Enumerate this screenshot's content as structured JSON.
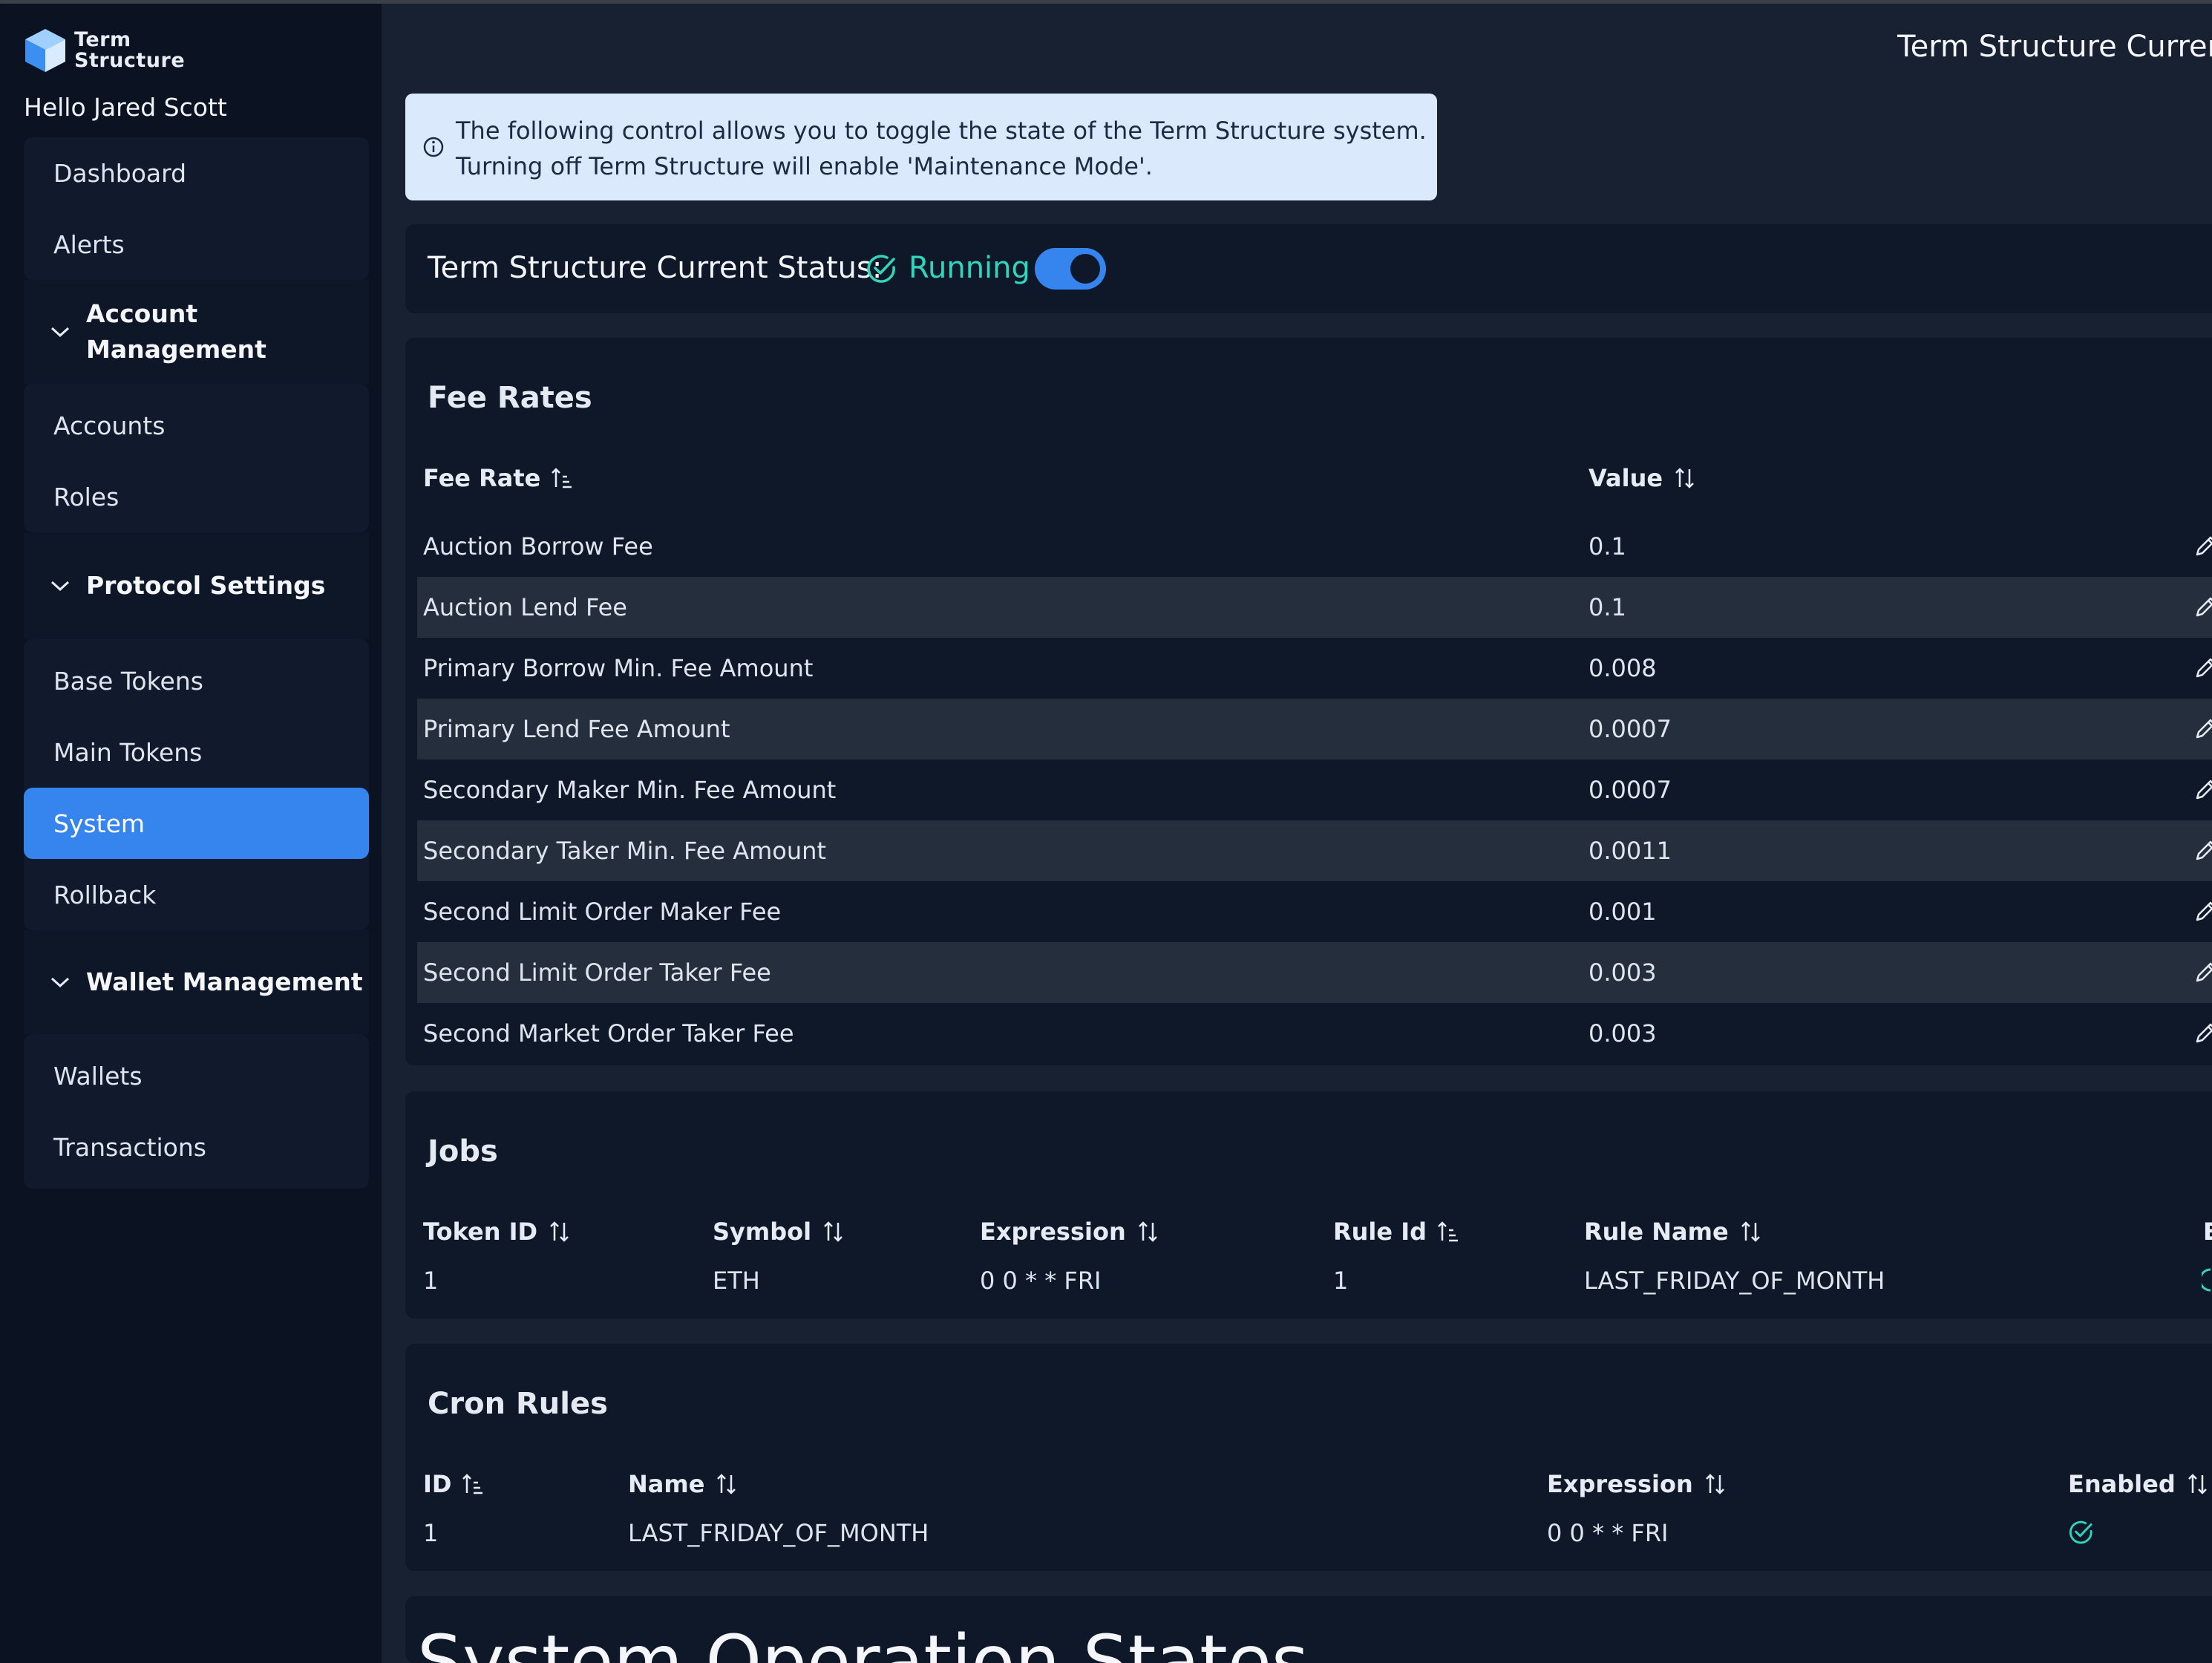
{
  "brand": {
    "line1": "Term",
    "line2": "Structure"
  },
  "greeting": "Hello Jared Scott",
  "sidebar": {
    "dashboard": "Dashboard",
    "alerts": "Alerts",
    "account_section": "Account Management",
    "accounts": "Accounts",
    "roles": "Roles",
    "protocol_section": "Protocol Settings",
    "base_tokens": "Base Tokens",
    "main_tokens": "Main Tokens",
    "system": "System",
    "rollback": "Rollback",
    "wallet_section": "Wallet Management",
    "wallets": "Wallets",
    "transactions": "Transactions"
  },
  "header": {
    "title": "Term Structure Current"
  },
  "info": {
    "line1": "The following control allows you to toggle the state of the Term Structure system.",
    "line2": "Turning off Term Structure will enable 'Maintenance Mode'."
  },
  "status": {
    "label": "Term Structure Current Status:",
    "value": "Running",
    "enabled": true
  },
  "fee_rates": {
    "title": "Fee Rates",
    "col_fee_rate": "Fee Rate",
    "col_value": "Value",
    "rows": [
      {
        "name": "Auction Borrow Fee",
        "value": "0.1"
      },
      {
        "name": "Auction Lend Fee",
        "value": "0.1"
      },
      {
        "name": "Primary Borrow Min. Fee Amount",
        "value": "0.008"
      },
      {
        "name": "Primary Lend Fee Amount",
        "value": "0.0007"
      },
      {
        "name": "Secondary Maker Min. Fee Amount",
        "value": "0.0007"
      },
      {
        "name": "Secondary Taker Min. Fee Amount",
        "value": "0.0011"
      },
      {
        "name": "Second Limit Order Maker Fee",
        "value": "0.001"
      },
      {
        "name": "Second Limit Order Taker Fee",
        "value": "0.003"
      },
      {
        "name": "Second Market Order Taker Fee",
        "value": "0.003"
      }
    ]
  },
  "jobs": {
    "title": "Jobs",
    "col_token_id": "Token ID",
    "col_symbol": "Symbol",
    "col_expression": "Expression",
    "col_rule_id": "Rule Id",
    "col_rule_name": "Rule Name",
    "col_partial": "E",
    "row": {
      "token_id": "1",
      "symbol": "ETH",
      "expression": "0 0 * * FRI",
      "rule_id": "1",
      "rule_name": "LAST_FRIDAY_OF_MONTH"
    }
  },
  "cron_rules": {
    "title": "Cron Rules",
    "col_id": "ID",
    "col_name": "Name",
    "col_expression": "Expression",
    "col_enabled": "Enabled",
    "row": {
      "id": "1",
      "name": "LAST_FRIDAY_OF_MONTH",
      "expression": "0 0 * * FRI",
      "enabled": true
    }
  },
  "system_states": {
    "title": "System Operation States"
  },
  "colors": {
    "accent": "#3684ee",
    "success": "#2fd6bd",
    "info_bg": "#dbe9fd",
    "sidebar_bg": "#0b1221",
    "main_bg": "#182131"
  }
}
